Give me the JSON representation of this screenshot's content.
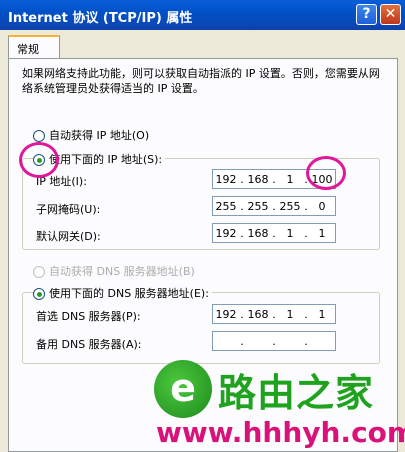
{
  "window": {
    "title": "Internet 协议 (TCP/IP) 属性"
  },
  "tabs": [
    {
      "label": "常规"
    }
  ],
  "description": "如果网络支持此功能，则可以获取自动指派的 IP 设置。否则，您需要从网络系统管理员处获得适当的 IP 设置。",
  "ip_mode": {
    "auto_label": "自动获得 IP 地址(O)",
    "manual_label": "使用下面的 IP 地址(S):",
    "selected": "manual"
  },
  "ip_fields": [
    {
      "label": "IP 地址(I):",
      "octets": [
        "192",
        "168",
        "1",
        "100"
      ]
    },
    {
      "label": "子网掩码(U):",
      "octets": [
        "255",
        "255",
        "255",
        "0"
      ]
    },
    {
      "label": "默认网关(D):",
      "octets": [
        "192",
        "168",
        "1",
        "1"
      ]
    }
  ],
  "dns_mode": {
    "auto_label": "自动获得 DNS 服务器地址(B)",
    "manual_label": "使用下面的 DNS 服务器地址(E):",
    "selected": "manual"
  },
  "dns_fields": [
    {
      "label": "首选 DNS 服务器(P):",
      "octets": [
        "192",
        "168",
        "1",
        "1"
      ]
    },
    {
      "label": "备用 DNS 服务器(A):",
      "octets": [
        "",
        "",
        "",
        ""
      ]
    }
  ],
  "watermark": {
    "brand": "路由之家",
    "url": "www.hhhyh.com"
  },
  "colors": {
    "titlebar": "#0a49b7",
    "highlight_ring": "#e0179c",
    "brand_green": "#1fa31f",
    "brand_pink": "#d8127a"
  }
}
